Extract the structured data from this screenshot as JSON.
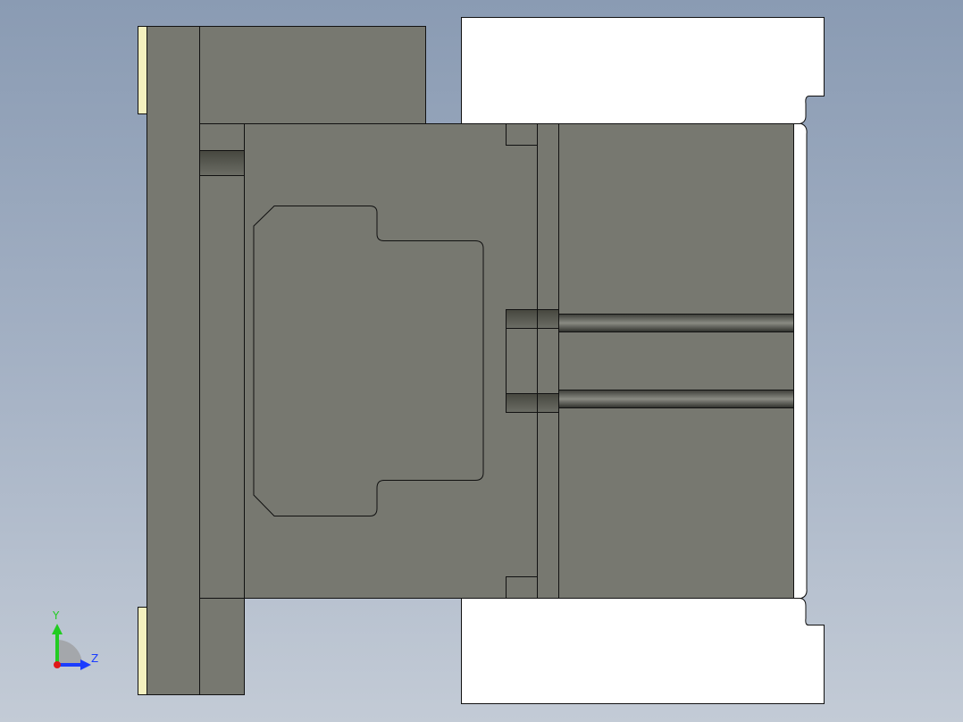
{
  "view": {
    "background_top": "#8a9bb3",
    "background_bottom": "#c3cbd6"
  },
  "part": {
    "body_color": "#777870",
    "edge_color": "#111111",
    "face_highlight_color": "#f4f0bf",
    "white_face_color": "#ffffff"
  },
  "triad": {
    "y_label": "Y",
    "z_label": "Z",
    "y_color": "#22cc22",
    "z_color": "#1a3cff",
    "x_color": "#e01818",
    "icon": "axis-triad-icon"
  }
}
